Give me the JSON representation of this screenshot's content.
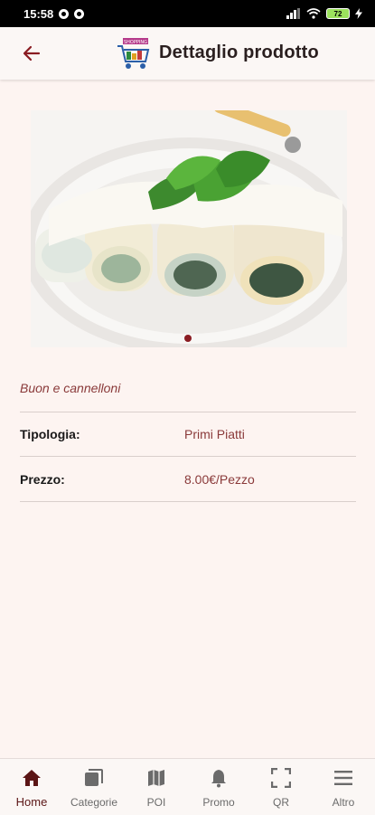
{
  "status_bar": {
    "time": "15:58",
    "battery": "72"
  },
  "header": {
    "title": "Dettaglio prodotto",
    "logo_text": "SHOPPING"
  },
  "product": {
    "description": "Buon e cannelloni",
    "carousel": {
      "slides": 1,
      "active_index": 0
    },
    "details": [
      {
        "label": "Tipologia:",
        "value": "Primi Piatti"
      },
      {
        "label": "Prezzo:",
        "value": "8.00€/Pezzo"
      }
    ]
  },
  "nav": {
    "items": [
      {
        "label": "Home",
        "icon": "home-icon",
        "active": true
      },
      {
        "label": "Categorie",
        "icon": "categories-icon",
        "active": false
      },
      {
        "label": "POI",
        "icon": "map-icon",
        "active": false
      },
      {
        "label": "Promo",
        "icon": "bell-icon",
        "active": false
      },
      {
        "label": "QR",
        "icon": "qr-scan-icon",
        "active": false
      },
      {
        "label": "Altro",
        "icon": "menu-icon",
        "active": false
      }
    ]
  },
  "colors": {
    "accent": "#8a1c22",
    "text_accent": "#8a3a3a",
    "background": "#fdf4f1"
  }
}
